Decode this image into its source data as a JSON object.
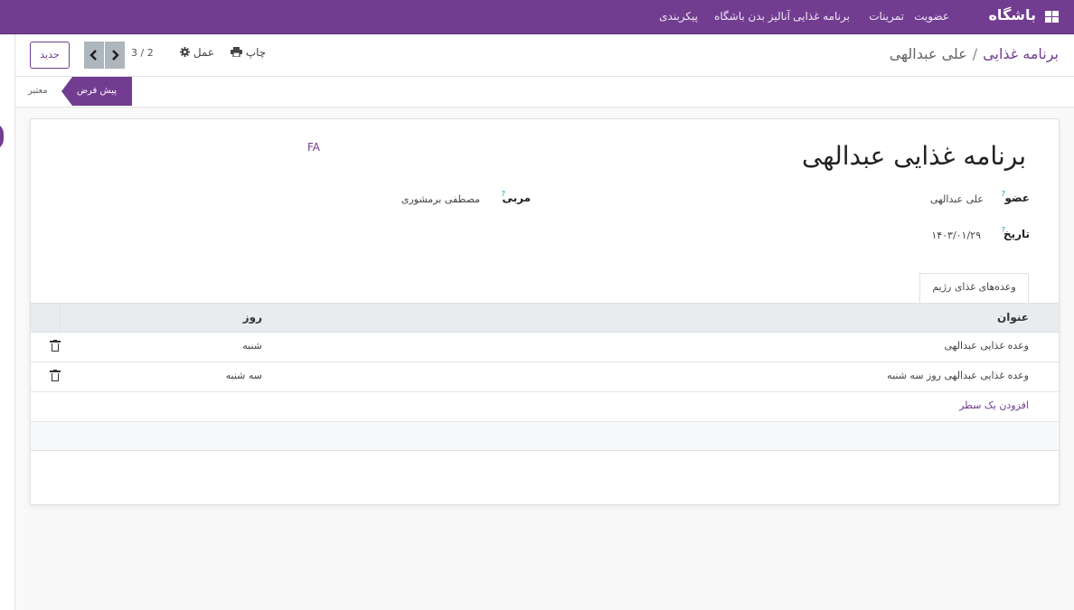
{
  "topbar": {
    "brand": "باشگاه",
    "menu": [
      "عضویت",
      "تمرینات",
      "برنامه غذایی",
      "آنالیز بدن باشگاه",
      "پیکربندی"
    ]
  },
  "breadcrumb": {
    "parent": "برنامه غذایی",
    "separator": "/",
    "current": "علی عبدالهی"
  },
  "toolbar": {
    "new_label": "جدید",
    "pager_value": "3 / 2",
    "action_label": "عمل",
    "print_label": "چاپ"
  },
  "status": {
    "active_stage": "پیش فرض",
    "other_stage": "معتبر"
  },
  "form": {
    "lang": "FA",
    "title": "برنامه غذایی عبدالهی",
    "member_label": "عضو",
    "member_value": "علی عبدالهی",
    "coach_label": "مربی",
    "coach_value": "مصطفی برمشوری",
    "date_label": "تاریخ",
    "date_value": "۱۴۰۳/۰۱/۲۹",
    "help_mark": "?"
  },
  "tab": {
    "label": "وعده‌های غذای رژیم"
  },
  "table": {
    "headers": {
      "title": "عنوان",
      "day": "روز"
    },
    "rows": [
      {
        "title": "وعده غذایی عبدالهی",
        "day": "شنبه"
      },
      {
        "title": "وعده غذایی عبدالهی روز سه شنبه",
        "day": "سه شنبه"
      }
    ],
    "add_line": "افزودن یک سطر"
  },
  "icons": {
    "apps": "apps-grid-icon",
    "print": "printer-icon",
    "action": "gear-icon",
    "prev": "chevron-left-icon",
    "next": "chevron-right-icon",
    "delete": "trash-icon"
  },
  "colors": {
    "brand": "#723d91",
    "pager": "#adb5bd"
  }
}
